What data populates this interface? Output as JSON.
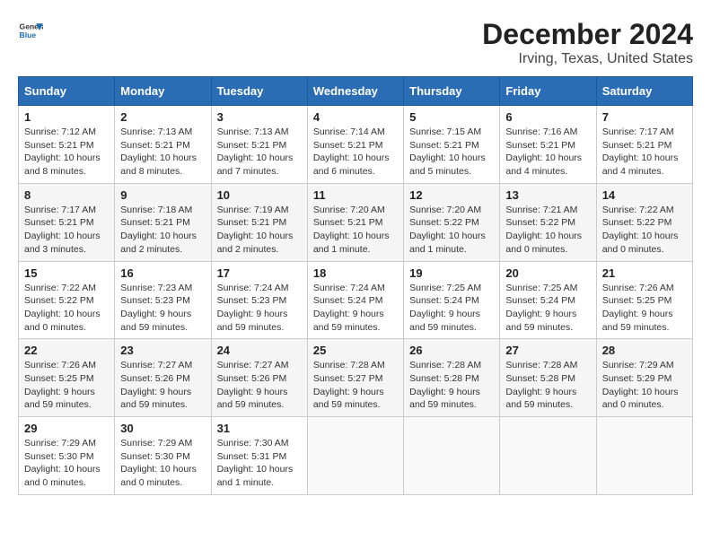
{
  "header": {
    "logo_general": "General",
    "logo_blue": "Blue",
    "month_title": "December 2024",
    "location": "Irving, Texas, United States"
  },
  "days_of_week": [
    "Sunday",
    "Monday",
    "Tuesday",
    "Wednesday",
    "Thursday",
    "Friday",
    "Saturday"
  ],
  "weeks": [
    [
      {
        "day": 1,
        "sunrise": "7:12 AM",
        "sunset": "5:21 PM",
        "daylight": "10 hours and 8 minutes."
      },
      {
        "day": 2,
        "sunrise": "7:13 AM",
        "sunset": "5:21 PM",
        "daylight": "10 hours and 8 minutes."
      },
      {
        "day": 3,
        "sunrise": "7:13 AM",
        "sunset": "5:21 PM",
        "daylight": "10 hours and 7 minutes."
      },
      {
        "day": 4,
        "sunrise": "7:14 AM",
        "sunset": "5:21 PM",
        "daylight": "10 hours and 6 minutes."
      },
      {
        "day": 5,
        "sunrise": "7:15 AM",
        "sunset": "5:21 PM",
        "daylight": "10 hours and 5 minutes."
      },
      {
        "day": 6,
        "sunrise": "7:16 AM",
        "sunset": "5:21 PM",
        "daylight": "10 hours and 4 minutes."
      },
      {
        "day": 7,
        "sunrise": "7:17 AM",
        "sunset": "5:21 PM",
        "daylight": "10 hours and 4 minutes."
      }
    ],
    [
      {
        "day": 8,
        "sunrise": "7:17 AM",
        "sunset": "5:21 PM",
        "daylight": "10 hours and 3 minutes."
      },
      {
        "day": 9,
        "sunrise": "7:18 AM",
        "sunset": "5:21 PM",
        "daylight": "10 hours and 2 minutes."
      },
      {
        "day": 10,
        "sunrise": "7:19 AM",
        "sunset": "5:21 PM",
        "daylight": "10 hours and 2 minutes."
      },
      {
        "day": 11,
        "sunrise": "7:20 AM",
        "sunset": "5:21 PM",
        "daylight": "10 hours and 1 minute."
      },
      {
        "day": 12,
        "sunrise": "7:20 AM",
        "sunset": "5:22 PM",
        "daylight": "10 hours and 1 minute."
      },
      {
        "day": 13,
        "sunrise": "7:21 AM",
        "sunset": "5:22 PM",
        "daylight": "10 hours and 0 minutes."
      },
      {
        "day": 14,
        "sunrise": "7:22 AM",
        "sunset": "5:22 PM",
        "daylight": "10 hours and 0 minutes."
      }
    ],
    [
      {
        "day": 15,
        "sunrise": "7:22 AM",
        "sunset": "5:22 PM",
        "daylight": "10 hours and 0 minutes."
      },
      {
        "day": 16,
        "sunrise": "7:23 AM",
        "sunset": "5:23 PM",
        "daylight": "9 hours and 59 minutes."
      },
      {
        "day": 17,
        "sunrise": "7:24 AM",
        "sunset": "5:23 PM",
        "daylight": "9 hours and 59 minutes."
      },
      {
        "day": 18,
        "sunrise": "7:24 AM",
        "sunset": "5:24 PM",
        "daylight": "9 hours and 59 minutes."
      },
      {
        "day": 19,
        "sunrise": "7:25 AM",
        "sunset": "5:24 PM",
        "daylight": "9 hours and 59 minutes."
      },
      {
        "day": 20,
        "sunrise": "7:25 AM",
        "sunset": "5:24 PM",
        "daylight": "9 hours and 59 minutes."
      },
      {
        "day": 21,
        "sunrise": "7:26 AM",
        "sunset": "5:25 PM",
        "daylight": "9 hours and 59 minutes."
      }
    ],
    [
      {
        "day": 22,
        "sunrise": "7:26 AM",
        "sunset": "5:25 PM",
        "daylight": "9 hours and 59 minutes."
      },
      {
        "day": 23,
        "sunrise": "7:27 AM",
        "sunset": "5:26 PM",
        "daylight": "9 hours and 59 minutes."
      },
      {
        "day": 24,
        "sunrise": "7:27 AM",
        "sunset": "5:26 PM",
        "daylight": "9 hours and 59 minutes."
      },
      {
        "day": 25,
        "sunrise": "7:28 AM",
        "sunset": "5:27 PM",
        "daylight": "9 hours and 59 minutes."
      },
      {
        "day": 26,
        "sunrise": "7:28 AM",
        "sunset": "5:28 PM",
        "daylight": "9 hours and 59 minutes."
      },
      {
        "day": 27,
        "sunrise": "7:28 AM",
        "sunset": "5:28 PM",
        "daylight": "9 hours and 59 minutes."
      },
      {
        "day": 28,
        "sunrise": "7:29 AM",
        "sunset": "5:29 PM",
        "daylight": "10 hours and 0 minutes."
      }
    ],
    [
      {
        "day": 29,
        "sunrise": "7:29 AM",
        "sunset": "5:30 PM",
        "daylight": "10 hours and 0 minutes."
      },
      {
        "day": 30,
        "sunrise": "7:29 AM",
        "sunset": "5:30 PM",
        "daylight": "10 hours and 0 minutes."
      },
      {
        "day": 31,
        "sunrise": "7:30 AM",
        "sunset": "5:31 PM",
        "daylight": "10 hours and 1 minute."
      },
      null,
      null,
      null,
      null
    ]
  ],
  "labels": {
    "sunrise": "Sunrise:",
    "sunset": "Sunset:",
    "daylight": "Daylight:"
  }
}
